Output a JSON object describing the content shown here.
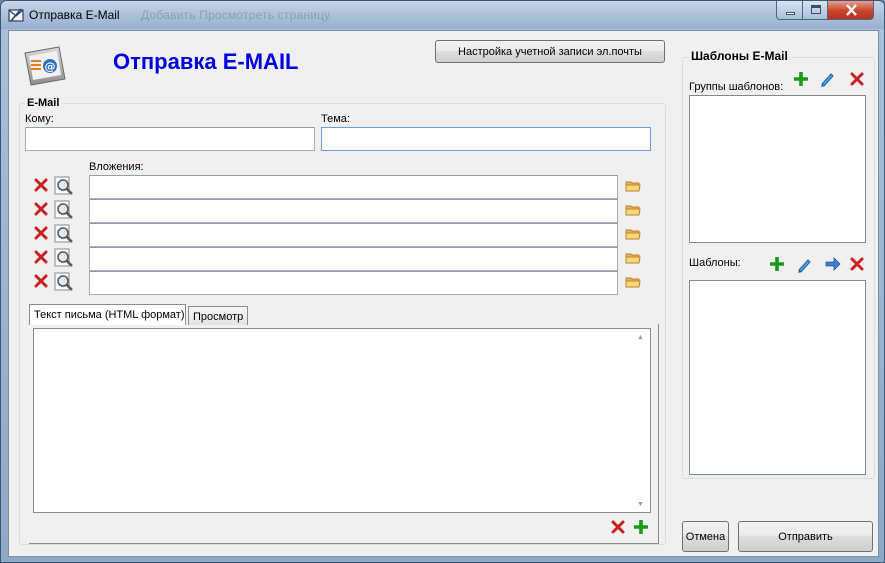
{
  "window": {
    "title": "Отправка E-Mail",
    "ghost_title": "Добавить   Просмотреть страницу"
  },
  "header": {
    "title": "Отправка E-MAIL",
    "account_button": "Настройка учетной записи эл.почты"
  },
  "email": {
    "group_label": "E-Mail",
    "to_label": "Кому:",
    "to_value": "",
    "subject_label": "Тема:",
    "subject_value": "",
    "attachments_label": "Вложения:",
    "attachments": [
      "",
      "",
      "",
      "",
      ""
    ]
  },
  "tabs": [
    {
      "label": "Текст письма (HTML формат)",
      "active": true
    },
    {
      "label": "Просмотр",
      "active": false
    }
  ],
  "templates": {
    "title": "Шаблоны E-Mail",
    "groups_label": "Группы шаблонов:",
    "templates_label": "Шаблоны:"
  },
  "buttons": {
    "cancel": "Отмена",
    "send": "Отправить"
  },
  "colors": {
    "title_blue": "#0000e0",
    "add_green": "#1a9a1a",
    "delete_red": "#cc1f1f"
  },
  "icons": [
    "email-app-icon",
    "delete-icon",
    "magnifier-icon",
    "folder-icon",
    "add-icon",
    "edit-pencil-icon",
    "move-arrow-icon"
  ]
}
